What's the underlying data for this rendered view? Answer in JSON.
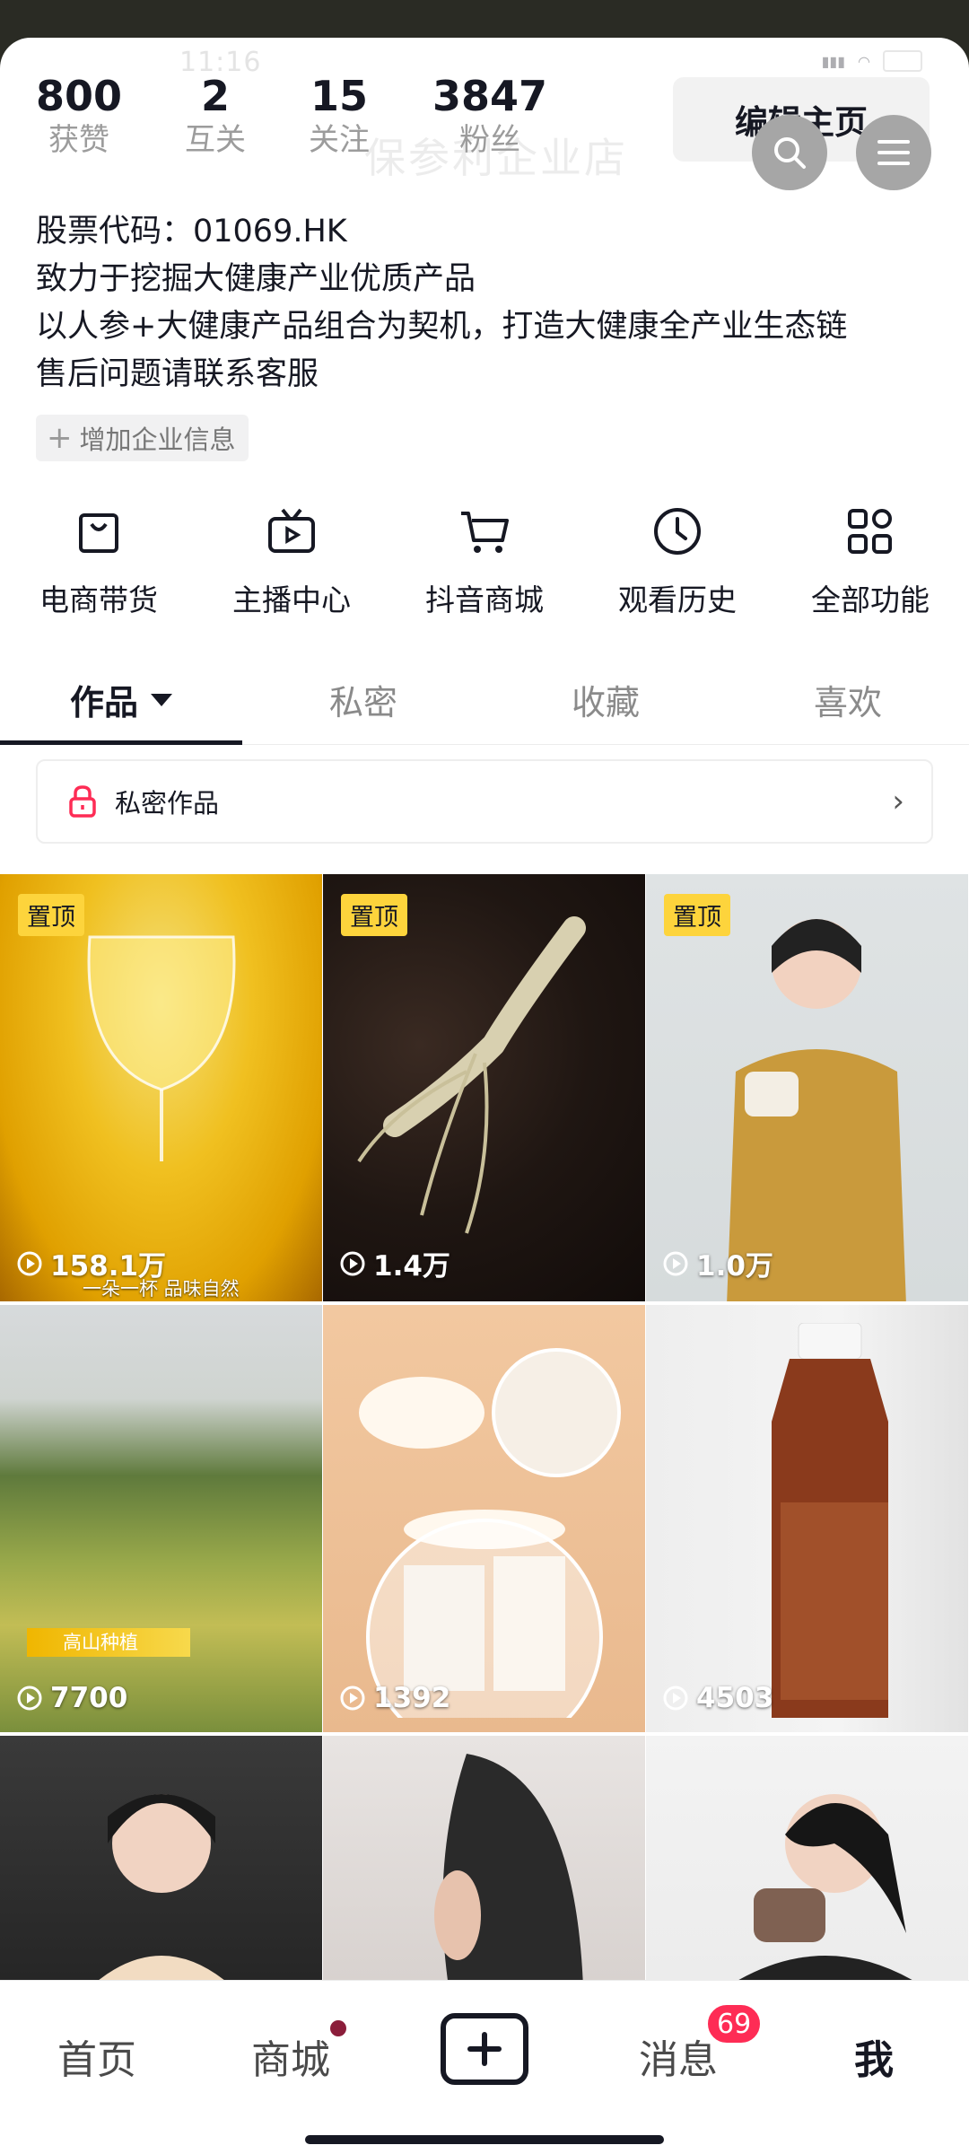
{
  "status": {
    "time": "11:16",
    "battery": "87"
  },
  "profile": {
    "shop_name": "保参利企业店",
    "stats": [
      {
        "num": "800",
        "label": "获赞"
      },
      {
        "num": "2",
        "label": "互关"
      },
      {
        "num": "15",
        "label": "关注"
      },
      {
        "num": "3847",
        "label": "粉丝"
      }
    ],
    "edit_label": "编辑主页",
    "bio": [
      "股票代码：01069.HK",
      "致力于挖掘大健康产业优质产品",
      "以人参+大健康产品组合为契机，打造大健康全产业生态链",
      "售后问题请联系客服"
    ],
    "add_info_label": "增加企业信息"
  },
  "tools": [
    {
      "label": "电商带货",
      "icon": "shopping-bag-icon"
    },
    {
      "label": "主播中心",
      "icon": "tv-icon"
    },
    {
      "label": "抖音商城",
      "icon": "cart-icon"
    },
    {
      "label": "观看历史",
      "icon": "clock-icon"
    },
    {
      "label": "全部功能",
      "icon": "grid-icon"
    }
  ],
  "tabs": [
    {
      "label": "作品"
    },
    {
      "label": "私密"
    },
    {
      "label": "收藏"
    },
    {
      "label": "喜欢"
    }
  ],
  "private_row": {
    "label": "私密作品"
  },
  "videos": [
    {
      "pinned": "置顶",
      "views": "158.1万",
      "caption": "一朵一杯 品味自然"
    },
    {
      "pinned": "置顶",
      "views": "1.4万"
    },
    {
      "pinned": "置顶",
      "views": "1.0万"
    },
    {
      "views": "7700",
      "chip": "高山种植"
    },
    {
      "views": "1392"
    },
    {
      "views": "4503"
    },
    {},
    {},
    {}
  ],
  "nav": {
    "home": "首页",
    "mall": "商城",
    "messages": "消息",
    "messages_badge": "69",
    "me": "我"
  },
  "colors": {
    "accent": "#fe2c55",
    "pin": "#fdd43c",
    "text": "#161823"
  }
}
